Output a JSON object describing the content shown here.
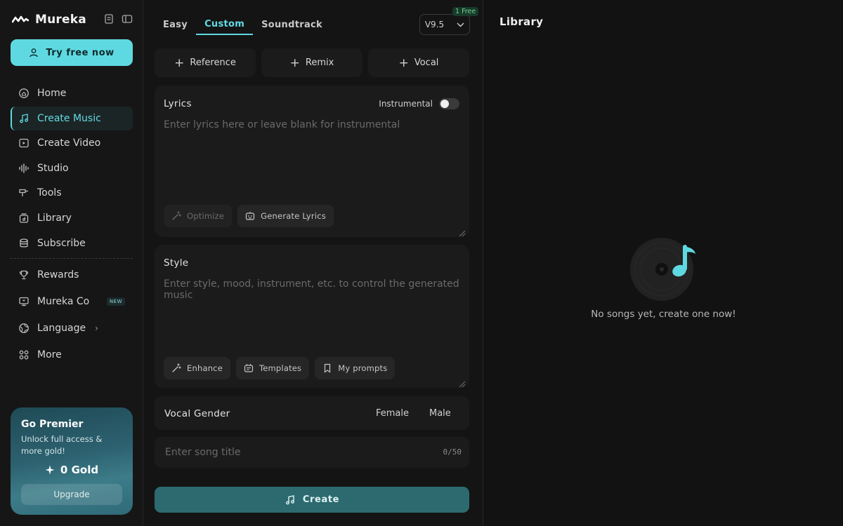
{
  "brand": {
    "name": "Mureka"
  },
  "sidebar": {
    "cta_label": "Try free now",
    "items": [
      {
        "label": "Home",
        "icon": "home-icon"
      },
      {
        "label": "Create Music",
        "icon": "music-note-icon",
        "active": true
      },
      {
        "label": "Create Video",
        "icon": "video-icon"
      },
      {
        "label": "Studio",
        "icon": "waveform-icon"
      },
      {
        "label": "Tools",
        "icon": "tools-icon"
      },
      {
        "label": "Library",
        "icon": "library-icon"
      },
      {
        "label": "Subscribe",
        "icon": "stack-icon"
      }
    ],
    "items2": [
      {
        "label": "Rewards",
        "icon": "trophy-icon"
      },
      {
        "label": "Mureka Co",
        "icon": "monitor-icon",
        "badge": "NEW"
      },
      {
        "label": "Language",
        "icon": "globe-icon"
      },
      {
        "label": "More",
        "icon": "grid-icon"
      }
    ],
    "premier": {
      "title": "Go Premier",
      "subtitle": "Unlock full access & more gold!",
      "gold": "0 Gold",
      "upgrade_label": "Upgrade"
    }
  },
  "create": {
    "tabs": [
      "Easy",
      "Custom",
      "Soundtrack"
    ],
    "active_tab": "Custom",
    "version": "V9.5",
    "free_badge": "1 Free",
    "chips": [
      "Reference",
      "Remix",
      "Vocal"
    ],
    "lyrics": {
      "title": "Lyrics",
      "placeholder": "Enter lyrics here or leave blank for instrumental",
      "instrumental_label": "Instrumental",
      "optimize_label": "Optimize",
      "generate_label": "Generate Lyrics"
    },
    "style": {
      "title": "Style",
      "placeholder": "Enter style, mood, instrument, etc. to control the generated music",
      "enhance_label": "Enhance",
      "templates_label": "Templates",
      "prompts_label": "My prompts"
    },
    "vocal_gender": {
      "label": "Vocal Gender",
      "female": "Female",
      "male": "Male"
    },
    "song_title": {
      "placeholder": "Enter song title",
      "counter": "0/50"
    },
    "create_label": "Create"
  },
  "library": {
    "title": "Library",
    "empty_text": "No songs yet, create one now!"
  },
  "colors": {
    "accent": "#5fd9e1",
    "create_button": "#2c6a6f",
    "background": "#131313"
  }
}
